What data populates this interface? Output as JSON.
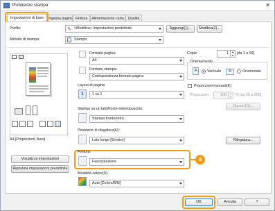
{
  "window": {
    "title": "Preferenze stampa",
    "close_glyph": "✕"
  },
  "tabs": [
    {
      "label": "Impostazioni di base",
      "active": true
    },
    {
      "label": "Imposta pagina"
    },
    {
      "label": "Finitura"
    },
    {
      "label": "Alimentazione carta"
    },
    {
      "label": "Qualità"
    }
  ],
  "profile": {
    "label": "Profilo:",
    "value": "<Modifica> Impostazioni predefinite",
    "add_button": "Aggiungi(1)...",
    "edit_button": "Modifica(2)..."
  },
  "print_method": {
    "label": "Metodo di stampa:",
    "value": "Stampa"
  },
  "preview": {
    "caption": "A4 [Proporzioni: Auto]",
    "show_settings_button": "Visualizza impostazioni",
    "restore_defaults_button": "Ripristina impostazioni predefinite"
  },
  "page_size": {
    "label": "Formato pagina:",
    "value": "A4"
  },
  "output_size": {
    "label": "Formato stampa:",
    "value": "Corrispondenza formato pagina"
  },
  "copies": {
    "label": "Copie:",
    "value": "1",
    "range": "[da 1 a 99]"
  },
  "orientation": {
    "label": "Orientamento",
    "portrait_label": "Verticale",
    "landscape_label": "Orizzontale",
    "portrait_letter": "A",
    "landscape_letter": "A",
    "selected": "Verticale"
  },
  "layout": {
    "label": "Layout di pagina:",
    "value": "1 su 1",
    "icon_text": "1"
  },
  "manual_scaling": {
    "label": "Proporzioni manuali(K)",
    "field_label": "Proporzioni:",
    "value": "100",
    "range": "% [da 25 a 200]"
  },
  "options_button": "Opzioni(G)...",
  "duplex": {
    "label": "Stampa su un lato/fronte-retro/opuscolo:",
    "value": "Stampa fronte/retro"
  },
  "binding": {
    "label": "Posizione di rilegatura(H):",
    "value": "Lato lungo [Sinistro]",
    "button": "Rilegatura..."
  },
  "finishing": {
    "label": "Finitura:",
    "value": "Fascicolazione",
    "callout": "a"
  },
  "color_mode": {
    "label": "Modalità colore(U):",
    "value": "Auto [Colore/B/N]"
  },
  "footer": {
    "ok": "OK",
    "cancel": "Annulla",
    "help": "?"
  },
  "colors": {
    "highlight": "#f29b17",
    "accent": "#2f6fbf"
  }
}
